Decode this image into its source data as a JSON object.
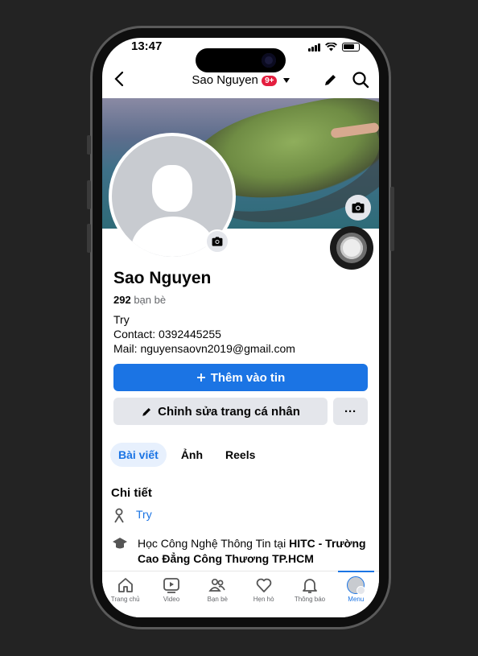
{
  "status": {
    "time": "13:47"
  },
  "header": {
    "title": "Sao Nguyen",
    "badge": "9+"
  },
  "profile": {
    "name": "Sao Nguyen",
    "friends_count": "292",
    "friends_label": "bạn bè",
    "bio": [
      "Try",
      "Contact: 0392445255",
      "Mail: nguyensaovn2019@gmail.com"
    ]
  },
  "actions": {
    "add_story": "Thêm vào tin",
    "edit_profile": "Chỉnh sửa trang cá nhân",
    "more": "···"
  },
  "tabs": [
    {
      "label": "Bài viết",
      "active": true
    },
    {
      "label": "Ảnh",
      "active": false
    },
    {
      "label": "Reels",
      "active": false
    }
  ],
  "details": {
    "title": "Chi tiết",
    "items": [
      {
        "text": "Try",
        "icon": "person-icon"
      },
      {
        "prefix": "Học Công Nghệ Thông Tin tại ",
        "bold": "HITC - Trường Cao Đẳng Công Thương TP.HCM",
        "icon": "graduation-cap-icon"
      }
    ]
  },
  "bottom_nav": [
    {
      "label": "Trang chủ",
      "icon": "home-icon"
    },
    {
      "label": "Video",
      "icon": "video-icon"
    },
    {
      "label": "Bạn bè",
      "icon": "friends-icon"
    },
    {
      "label": "Hẹn hò",
      "icon": "dating-heart-icon"
    },
    {
      "label": "Thông báo",
      "icon": "bell-icon"
    },
    {
      "label": "Menu",
      "icon": "menu-avatar-icon",
      "active": true
    }
  ],
  "colors": {
    "accent": "#1b74e4",
    "badge": "#e41e3f"
  }
}
